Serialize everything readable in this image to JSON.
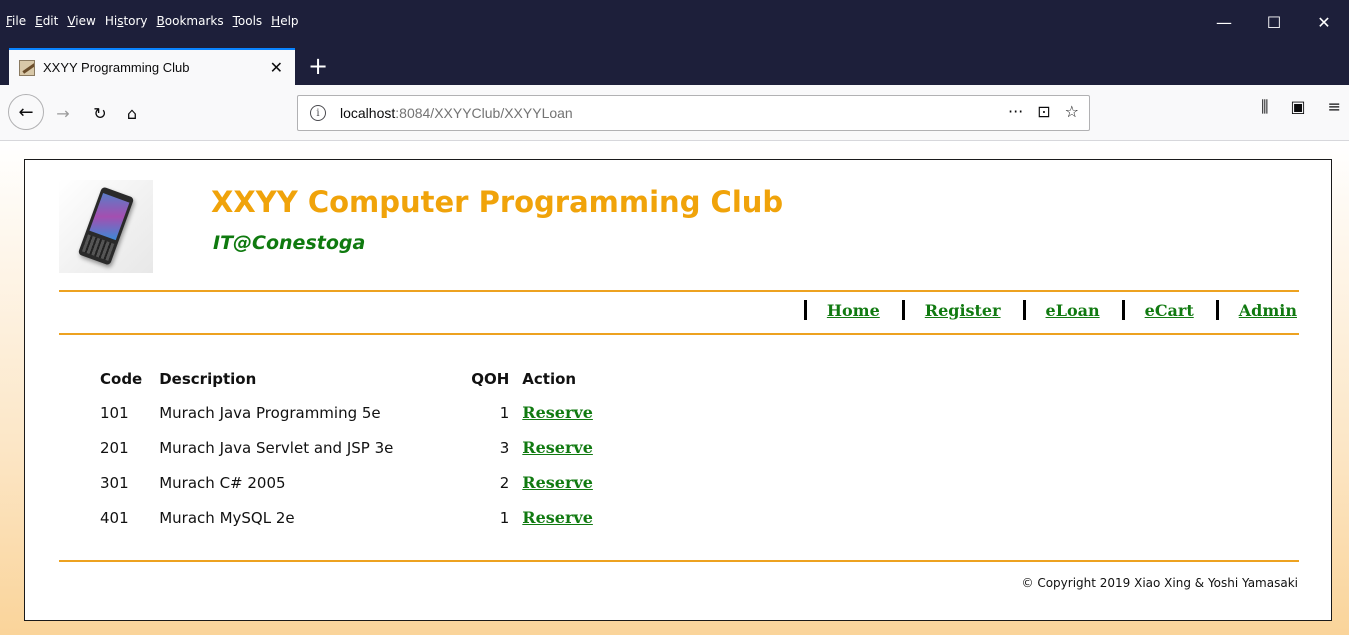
{
  "browser": {
    "menu": [
      "File",
      "Edit",
      "View",
      "History",
      "Bookmarks",
      "Tools",
      "Help"
    ],
    "menu_accel": [
      "F",
      "E",
      "V",
      "s",
      "B",
      "T",
      "H"
    ],
    "tab_title": "XXYY Programming Club",
    "url_host": "localhost",
    "url_path": ":8084/XXYYClub/XXYYLoan",
    "window_controls": {
      "minimize": "—",
      "maximize": "☐",
      "close": "✕"
    }
  },
  "site": {
    "title": "XXYY Computer Programming Club",
    "subtitle": "IT@Conestoga",
    "nav": [
      "Home",
      "Register",
      "eLoan",
      "eCart",
      "Admin"
    ]
  },
  "inventory": {
    "headers": {
      "code": "Code",
      "description": "Description",
      "qoh": "QOH",
      "action": "Action"
    },
    "rows": [
      {
        "code": "101",
        "description": "Murach Java Programming 5e",
        "qoh": "1",
        "action": "Reserve"
      },
      {
        "code": "201",
        "description": "Murach Java Servlet and JSP 3e",
        "qoh": "3",
        "action": "Reserve"
      },
      {
        "code": "301",
        "description": "Murach C# 2005",
        "qoh": "2",
        "action": "Reserve"
      },
      {
        "code": "401",
        "description": "Murach MySQL 2e",
        "qoh": "1",
        "action": "Reserve"
      }
    ]
  },
  "footer": {
    "copyright": "© Copyright 2019 Xiao Xing & Yoshi Yamasaki"
  },
  "colors": {
    "title": "#f0a30a",
    "subtitle": "#0f7a0f",
    "link": "#117a11",
    "rule": "#eda220",
    "chrome_dark": "#1d1f3a"
  }
}
